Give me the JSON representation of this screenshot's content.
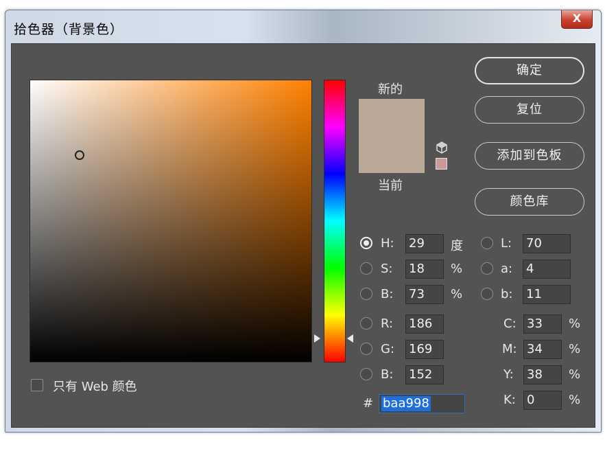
{
  "window": {
    "title": "拾色器（背景色）",
    "close_label": "X"
  },
  "colors": {
    "new_color": "#baa998",
    "current_color": "#baa998",
    "web_safe_swatch": "#cc9999"
  },
  "preview": {
    "new_label": "新的",
    "current_label": "当前"
  },
  "buttons": {
    "ok": "确定",
    "reset": "复位",
    "add_swatch": "添加到色板",
    "color_libraries": "颜色库"
  },
  "hsb": {
    "h_label": "H:",
    "h_value": "29",
    "h_unit": "度",
    "s_label": "S:",
    "s_value": "18",
    "s_unit": "%",
    "b_label": "B:",
    "b_value": "73",
    "b_unit": "%"
  },
  "rgb": {
    "r_label": "R:",
    "r_value": "186",
    "g_label": "G:",
    "g_value": "169",
    "b_label": "B:",
    "b_value": "152"
  },
  "lab": {
    "l_label": "L:",
    "l_value": "70",
    "a_label": "a:",
    "a_value": "4",
    "b_label": "b:",
    "b_value": "11"
  },
  "cmyk": {
    "c_label": "C:",
    "c_value": "33",
    "c_unit": "%",
    "m_label": "M:",
    "m_value": "34",
    "m_unit": "%",
    "y_label": "Y:",
    "y_value": "38",
    "y_unit": "%",
    "k_label": "K:",
    "k_value": "0",
    "k_unit": "%"
  },
  "hex": {
    "label": "#",
    "value": "baa998"
  },
  "web_only": {
    "label": "只有 Web 颜色",
    "checked": false
  }
}
